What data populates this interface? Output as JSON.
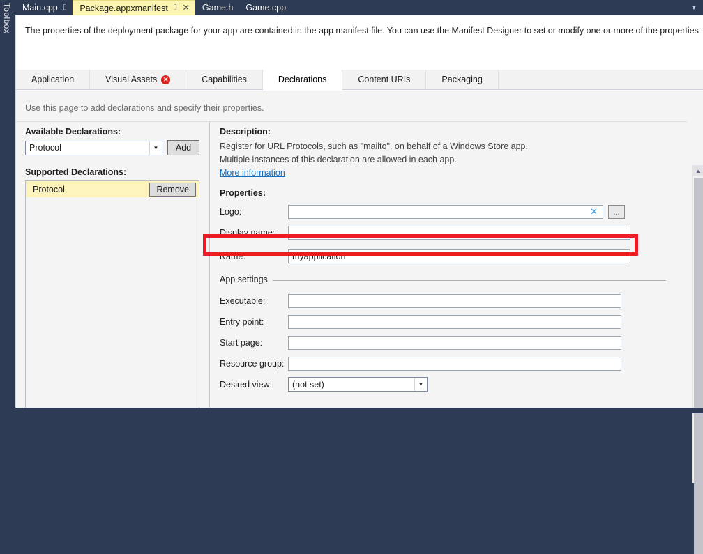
{
  "window": {
    "toolbox_label": "Toolbox",
    "overflow_icon": "chevron-down-icon",
    "overflow_glyph": "▼"
  },
  "doc_tabs": [
    {
      "label": "Main.cpp",
      "active": false,
      "pin": "⌷",
      "close": ""
    },
    {
      "label": "Package.appxmanifest",
      "active": true,
      "pin": "⌷",
      "close": "✕"
    },
    {
      "label": "Game.h",
      "active": false,
      "pin": "",
      "close": ""
    },
    {
      "label": "Game.cpp",
      "active": false,
      "pin": "",
      "close": ""
    }
  ],
  "banner": {
    "text": "The properties of the deployment package for your app are contained in the app manifest file. You can use the Manifest Designer to set or modify one or more of the properties."
  },
  "page_tabs": [
    {
      "label": "Application",
      "active": false,
      "badge": ""
    },
    {
      "label": "Visual Assets",
      "active": false,
      "badge": "✕"
    },
    {
      "label": "Capabilities",
      "active": false,
      "badge": ""
    },
    {
      "label": "Declarations",
      "active": true,
      "badge": ""
    },
    {
      "label": "Content URIs",
      "active": false,
      "badge": ""
    },
    {
      "label": "Packaging",
      "active": false,
      "badge": ""
    }
  ],
  "page": {
    "hint": "Use this page to add declarations and specify their properties.",
    "available_label": "Available Declarations:",
    "available_value": "Protocol",
    "add_button": "Add",
    "supported_label": "Supported Declarations:",
    "supported_items": [
      {
        "name": "Protocol",
        "remove_button": "Remove",
        "selected": true
      }
    ]
  },
  "details": {
    "description_label": "Description:",
    "description_lines": [
      "Register for URL Protocols, such as \"mailto\", on behalf of a Windows Store app.",
      "Multiple instances of this declaration are allowed in each app."
    ],
    "more_information": "More information",
    "properties_label": "Properties:",
    "fields": [
      {
        "label": "Logo:",
        "value": "",
        "placeholder": "",
        "kind": "text-clear-browse"
      },
      {
        "label": "Display name:",
        "value": "",
        "placeholder": "",
        "kind": "text"
      },
      {
        "label": "Name:",
        "value": "myapplication",
        "placeholder": "",
        "kind": "text",
        "highlighted": true
      }
    ],
    "group_title": "App settings",
    "app_settings_fields": [
      {
        "label": "Executable:",
        "value": "",
        "placeholder": "",
        "kind": "text"
      },
      {
        "label": "Entry point:",
        "value": "",
        "placeholder": "",
        "kind": "text"
      },
      {
        "label": "Start page:",
        "value": "",
        "placeholder": "",
        "kind": "text"
      },
      {
        "label": "Resource group:",
        "value": "",
        "placeholder": "",
        "kind": "text"
      },
      {
        "label": "Desired view:",
        "value": "(not set)",
        "placeholder": "",
        "kind": "combo"
      }
    ],
    "clear_icon": "✕",
    "browse_button": "...",
    "combo_arrow": "▼"
  },
  "scrollbar": {
    "up_arrow": "▲"
  },
  "colors": {
    "chrome": "#2d3b55",
    "active_tab": "#fdf6b3",
    "highlight_red": "#ed1c24",
    "link_blue": "#1570c1",
    "error_red": "#e02020"
  }
}
